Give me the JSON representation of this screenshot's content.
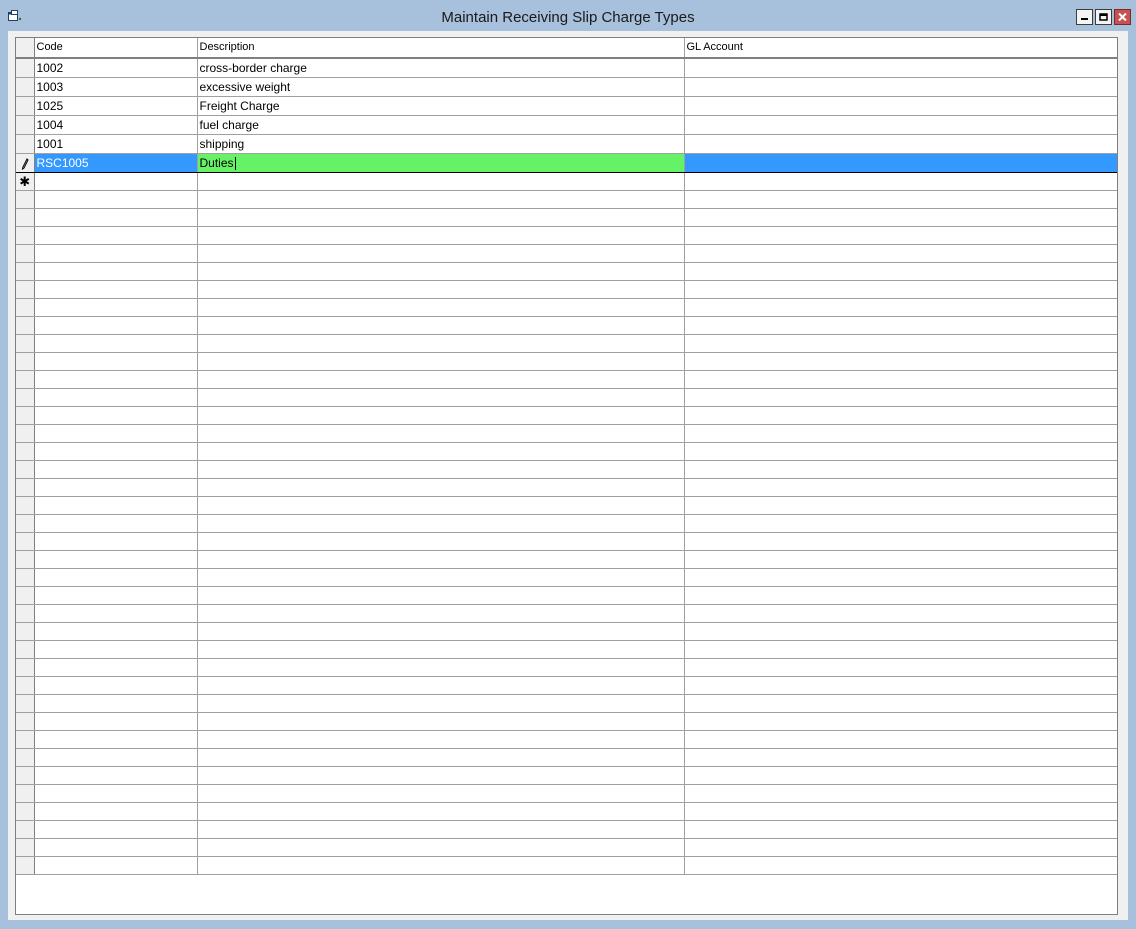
{
  "window": {
    "title": "Maintain Receiving Slip Charge Types",
    "icon": "app-window-icon",
    "buttons": [
      "minimize-icon",
      "maximize-icon",
      "close-icon"
    ],
    "close_color": "#c75050",
    "frame_color": "#a7c0dc"
  },
  "grid": {
    "columns": [
      "Code",
      "Description",
      "GL Account"
    ],
    "rows": [
      {
        "code": "1002",
        "description": "cross-border charge",
        "gl_account": ""
      },
      {
        "code": "1003",
        "description": "excessive weight",
        "gl_account": ""
      },
      {
        "code": "1025",
        "description": "Freight Charge",
        "gl_account": ""
      },
      {
        "code": "1004",
        "description": "fuel charge",
        "gl_account": ""
      },
      {
        "code": "1001",
        "description": "shipping",
        "gl_account": ""
      }
    ],
    "editing_row": {
      "indicator": "pencil-icon",
      "code": "RSC1005",
      "description": "Duties",
      "gl_account": ""
    },
    "new_row": {
      "indicator": "asterisk-icon",
      "glyph": "✱"
    },
    "selection_color": "#3399ff",
    "edit_cell_color": "#66f266"
  }
}
